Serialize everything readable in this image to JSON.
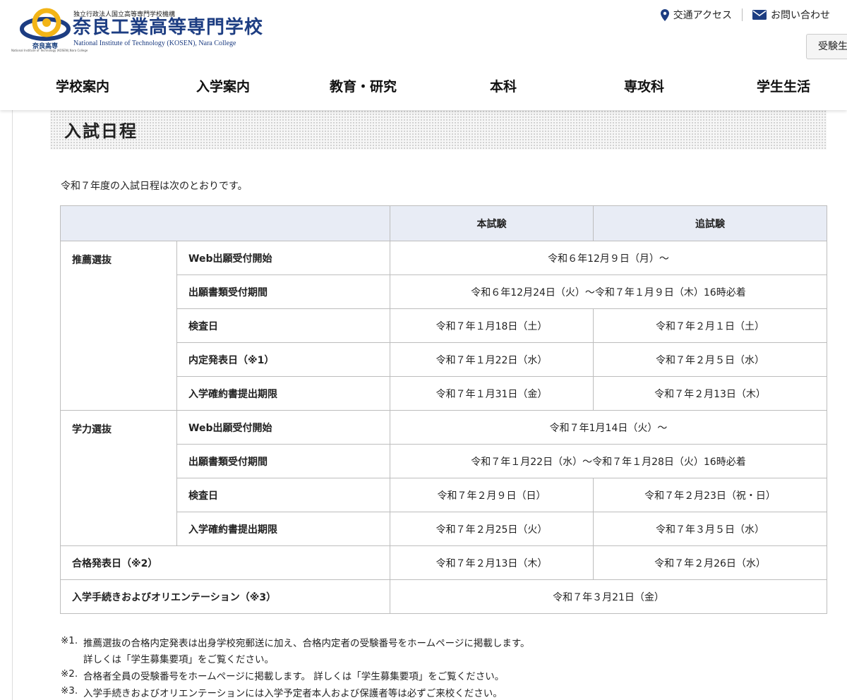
{
  "header": {
    "org_line": "独立行政法人国立高等専門学校機構",
    "school_name": "奈良工業高等専門学校",
    "school_name_en": "National Institute of Technology (KOSEN), Nara College",
    "emblem_caption": "奈良高専",
    "emblem_caption_sub": "National Institute of Technology (KOSEN),Nara College",
    "access_label": "交通アクセス",
    "contact_label": "お問い合わせ",
    "exam_button_label": "受験生",
    "brand_color": "#1d3d82",
    "accent_color": "#f2b417"
  },
  "nav": [
    "学校案内",
    "入学案内",
    "教育・研究",
    "本科",
    "専攻科",
    "学生生活"
  ],
  "page": {
    "title": "入試日程",
    "intro": "令和７年度の入試日程は次のとおりです。"
  },
  "table": {
    "col_headers": [
      "本試験",
      "追試験"
    ],
    "suisen": {
      "label": "推薦選抜",
      "rows": [
        {
          "item": "Web出願受付開始",
          "value": "令和６年12月９日（月）～"
        },
        {
          "item": "出願書類受付期間",
          "value": "令和６年12月24日（火）～令和７年１月９日（木）16時必着"
        },
        {
          "item": "検査日",
          "main": "令和７年１月18日（土）",
          "makeup": "令和７年２月１日（土）"
        },
        {
          "item": "内定発表日（※1）",
          "main": "令和７年１月22日（水）",
          "makeup": "令和７年２月５日（水）"
        },
        {
          "item": "入学確約書提出期限",
          "main": "令和７年１月31日（金）",
          "makeup": "令和７年２月13日（木）"
        }
      ]
    },
    "gakuryoku": {
      "label": "学力選抜",
      "rows": [
        {
          "item": "Web出願受付開始",
          "value": "令和７年1月14日（火）～"
        },
        {
          "item": "出願書類受付期間",
          "value": "令和７年１月22日（水）～令和７年１月28日（火）16時必着"
        },
        {
          "item": "検査日",
          "main": "令和７年２月９日（日）",
          "makeup": "令和７年２月23日（祝・日）"
        },
        {
          "item": "入学確約書提出期限",
          "main": "令和７年２月25日（火）",
          "makeup": "令和７年３月５日（水）"
        }
      ]
    },
    "pass_announce": {
      "label": "合格発表日（※2）",
      "main": "令和７年２月13日（木）",
      "makeup": "令和７年２月26日（水）"
    },
    "orientation": {
      "label": "入学手続きおよびオリエンテーション（※3）",
      "value": "令和７年３月21日（金）"
    }
  },
  "notes": [
    {
      "mark": "※1.",
      "text": "推薦選抜の合格内定発表は出身学校宛郵送に加え、合格内定者の受験番号をホームページに掲載します。",
      "text2": "詳しくは「学生募集要項」をご覧ください。"
    },
    {
      "mark": "※2.",
      "text": "合格者全員の受験番号をホームページに掲載します。 詳しくは「学生募集要項」をご覧ください。"
    },
    {
      "mark": "※3.",
      "text": "入学手続きおよびオリエンテーションには入学予定者本人および保護者等は必ずご来校ください。"
    }
  ]
}
